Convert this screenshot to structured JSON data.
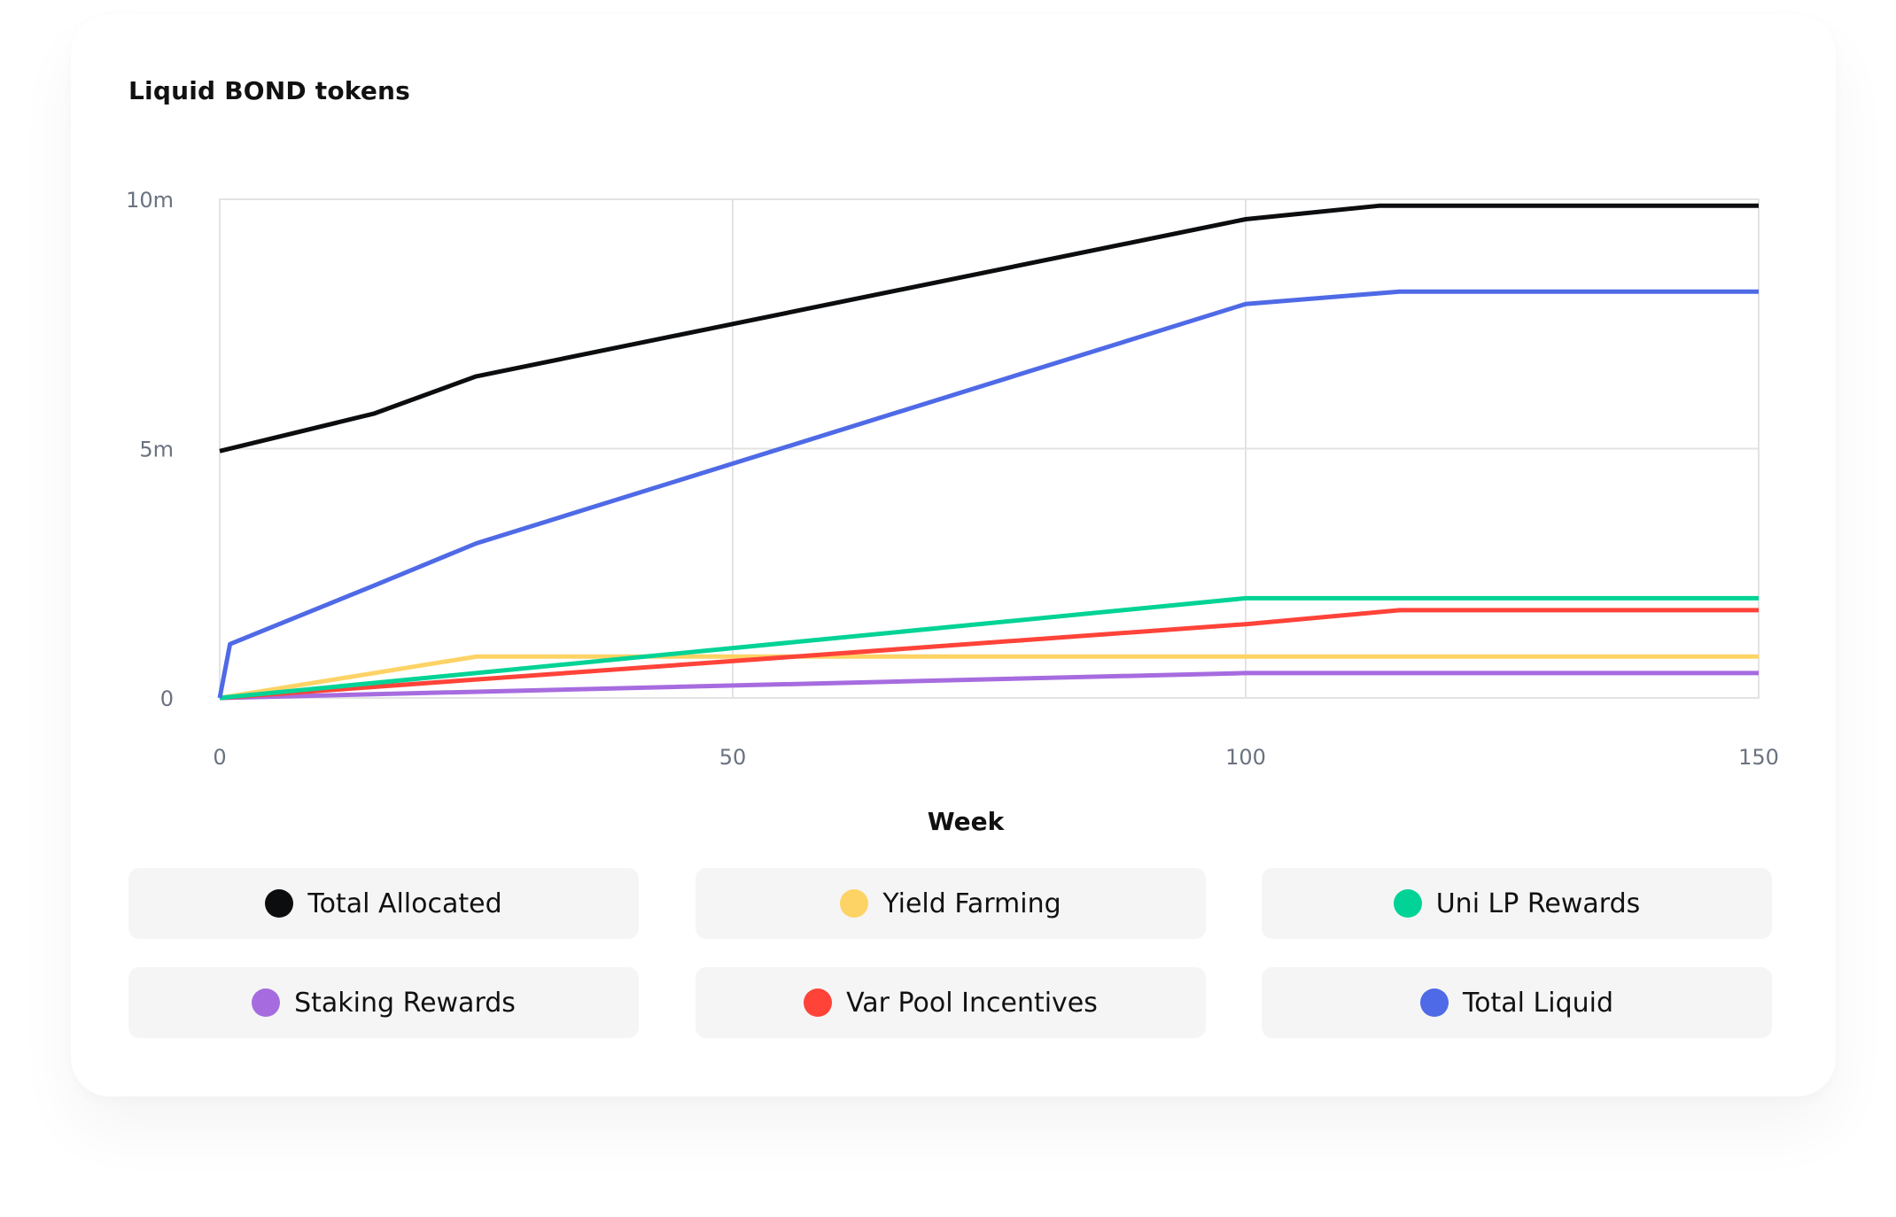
{
  "chart_data": {
    "type": "line",
    "title": "Liquid BOND tokens",
    "xlabel": "Week",
    "ylabel": "",
    "xlim": [
      0,
      150
    ],
    "ylim": [
      0,
      10000000
    ],
    "x_ticks": [
      {
        "value": 0,
        "label": "0"
      },
      {
        "value": 50,
        "label": "50"
      },
      {
        "value": 100,
        "label": "100"
      },
      {
        "value": 150,
        "label": "150"
      }
    ],
    "y_ticks": [
      {
        "value": 0,
        "label": "0"
      },
      {
        "value": 5000000,
        "label": "5m"
      },
      {
        "value": 10000000,
        "label": "10m"
      }
    ],
    "grid": true,
    "legend_position": "bottom",
    "series": [
      {
        "name": "Total Allocated",
        "color": "#0b0d0f",
        "points": [
          [
            0,
            4950000
          ],
          [
            15,
            5700000
          ],
          [
            25,
            6450000
          ],
          [
            100,
            9600000
          ],
          [
            113,
            9870000
          ],
          [
            150,
            9870000
          ]
        ]
      },
      {
        "name": "Yield Farming",
        "color": "#fdd365",
        "points": [
          [
            0,
            0
          ],
          [
            25,
            830000
          ],
          [
            150,
            830000
          ]
        ]
      },
      {
        "name": "Uni LP Rewards",
        "color": "#00d395",
        "points": [
          [
            0,
            0
          ],
          [
            100,
            2000000
          ],
          [
            150,
            2000000
          ]
        ]
      },
      {
        "name": "Staking Rewards",
        "color": "#a66cdf",
        "points": [
          [
            0,
            0
          ],
          [
            100,
            500000
          ],
          [
            150,
            500000
          ]
        ]
      },
      {
        "name": "Var Pool Incentives",
        "color": "#ff4339",
        "points": [
          [
            0,
            0
          ],
          [
            100,
            1480000
          ],
          [
            115,
            1760000
          ],
          [
            150,
            1760000
          ]
        ]
      },
      {
        "name": "Total Liquid",
        "color": "#4f6ae6",
        "points": [
          [
            0,
            0
          ],
          [
            1,
            1080000
          ],
          [
            15,
            2250000
          ],
          [
            25,
            3100000
          ],
          [
            100,
            7900000
          ],
          [
            115,
            8150000
          ],
          [
            150,
            8150000
          ]
        ]
      }
    ]
  },
  "legend": [
    {
      "label": "Total Allocated",
      "color": "#0b0d0f"
    },
    {
      "label": "Yield Farming",
      "color": "#fdd365"
    },
    {
      "label": "Uni LP Rewards",
      "color": "#00d395"
    },
    {
      "label": "Staking Rewards",
      "color": "#a66cdf"
    },
    {
      "label": "Var Pool Incentives",
      "color": "#ff4339"
    },
    {
      "label": "Total Liquid",
      "color": "#4f6ae6"
    }
  ]
}
